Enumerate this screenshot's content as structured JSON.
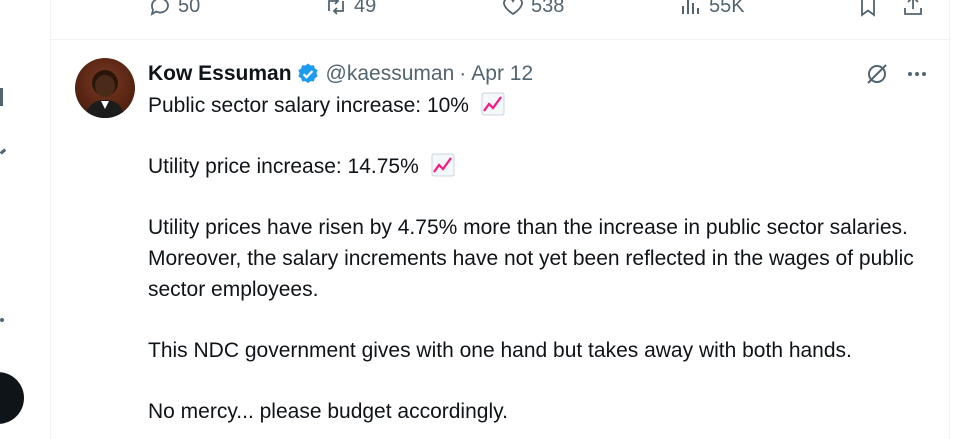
{
  "prev_tweet_actions": {
    "replies": "50",
    "retweets": "49",
    "likes": "538",
    "views": "55K"
  },
  "tweet": {
    "author_name": "Kow Essuman",
    "handle": "@kaessuman",
    "separator": "·",
    "date": "Apr 12",
    "lines": [
      "Public sector salary increase: 10%",
      "Utility price increase: 14.75%",
      "Utility prices have risen by 4.75% more than the increase in public sector salaries. Moreover, the salary increments have not yet been reflected in the wages of public sector employees.",
      "This NDC government gives with one hand but takes away with both hands.",
      "No mercy... please budget accordingly."
    ],
    "emoji": "chart-increasing-icon"
  },
  "colors": {
    "text": "#0f1419",
    "muted": "#536471",
    "verified": "#1d9bf0",
    "border": "#eff3f4",
    "emoji_line": "#f91880"
  }
}
